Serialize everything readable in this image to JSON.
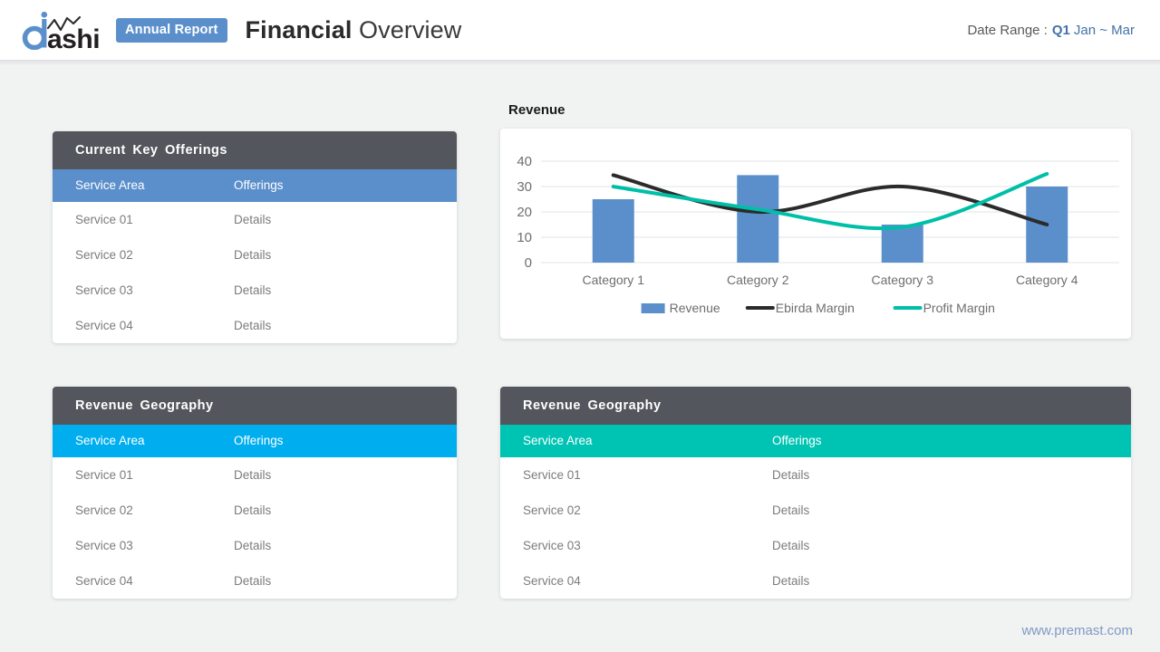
{
  "header": {
    "logo_text": "dashi",
    "badge_label": "Annual Report",
    "title_bold": "Financial",
    "title_light": " Overview",
    "date_label": "Date Range :",
    "date_quarter": "Q1",
    "date_range": "Jan ~ Mar"
  },
  "colors": {
    "brand_blue": "#5b8fcb",
    "header_dark": "#53565c",
    "accent_cyan": "#00aeef",
    "accent_teal": "#00c4b3",
    "page_bg": "#f1f2f2",
    "line_black": "#2b2b2b",
    "footer_link": "#7e9cc4"
  },
  "cards": {
    "offerings": {
      "title": "Current Key Offerings",
      "accent": "blue",
      "columns": [
        "Service Area",
        "Offerings"
      ],
      "rows": [
        [
          "Service 01",
          "Details"
        ],
        [
          "Service 02",
          "Details"
        ],
        [
          "Service 03",
          "Details"
        ],
        [
          "Service 04",
          "Details"
        ]
      ]
    },
    "geo_left": {
      "title": "Revenue Geography",
      "accent": "cyan",
      "columns": [
        "Service Area",
        "Offerings"
      ],
      "rows": [
        [
          "Service 01",
          "Details"
        ],
        [
          "Service 02",
          "Details"
        ],
        [
          "Service 03",
          "Details"
        ],
        [
          "Service 04",
          "Details"
        ]
      ]
    },
    "geo_right": {
      "title": "Revenue Geography",
      "accent": "teal",
      "columns": [
        "Service Area",
        "Offerings"
      ],
      "rows": [
        [
          "Service 01",
          "Details"
        ],
        [
          "Service 02",
          "Details"
        ],
        [
          "Service 03",
          "Details"
        ],
        [
          "Service 04",
          "Details"
        ]
      ]
    }
  },
  "chart_title": "Revenue",
  "chart_data": {
    "type": "bar",
    "title": "Revenue",
    "xlabel": "",
    "ylabel": "",
    "categories": [
      "Category 1",
      "Category 2",
      "Category 3",
      "Category 4"
    ],
    "yticks": [
      0,
      10,
      20,
      30,
      40
    ],
    "ylim": [
      0,
      40
    ],
    "grid": true,
    "legend_position": "bottom",
    "series": [
      {
        "name": "Revenue",
        "type": "bar",
        "color": "#5b8fcb",
        "values": [
          25,
          34.5,
          15,
          30
        ]
      },
      {
        "name": "Ebirda Margin",
        "type": "line",
        "color": "#2b2b2b",
        "values": [
          34.5,
          20,
          30,
          15
        ]
      },
      {
        "name": "Profit Margin",
        "type": "line",
        "color": "#00bfa8",
        "values": [
          30,
          21,
          14,
          35
        ]
      }
    ]
  },
  "footer": {
    "url": "www.premast.com"
  }
}
